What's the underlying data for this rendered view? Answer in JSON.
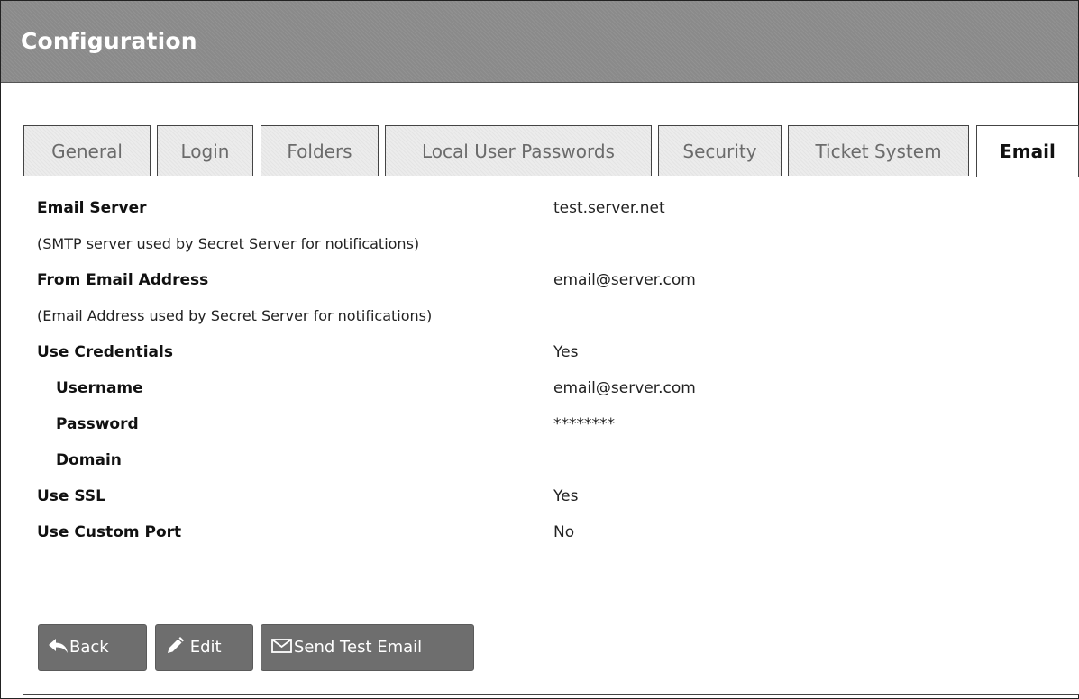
{
  "header": {
    "title": "Configuration"
  },
  "tabs": [
    {
      "label": "General"
    },
    {
      "label": "Login"
    },
    {
      "label": "Folders"
    },
    {
      "label": "Local User Passwords"
    },
    {
      "label": "Security"
    },
    {
      "label": "Ticket System"
    },
    {
      "label": "Email",
      "active": true
    }
  ],
  "settings": {
    "email_server": {
      "label": "Email Server",
      "value": "test.server.net",
      "description": "(SMTP server used by Secret Server for notifications)"
    },
    "from_email": {
      "label": "From Email Address",
      "value": "email@server.com",
      "description": "(Email Address used by Secret Server for notifications)"
    },
    "use_credentials": {
      "label": "Use Credentials",
      "value": "Yes"
    },
    "username": {
      "label": "Username",
      "value": "email@server.com"
    },
    "password": {
      "label": "Password",
      "value": "********"
    },
    "domain": {
      "label": "Domain",
      "value": ""
    },
    "use_ssl": {
      "label": "Use SSL",
      "value": "Yes"
    },
    "use_custom_port": {
      "label": "Use Custom Port",
      "value": "No"
    }
  },
  "buttons": {
    "back": {
      "label": "Back",
      "icon": "reply-arrow-icon"
    },
    "edit": {
      "label": "Edit",
      "icon": "pencil-icon"
    },
    "send_test": {
      "label": "Send Test Email",
      "icon": "envelope-icon"
    }
  }
}
